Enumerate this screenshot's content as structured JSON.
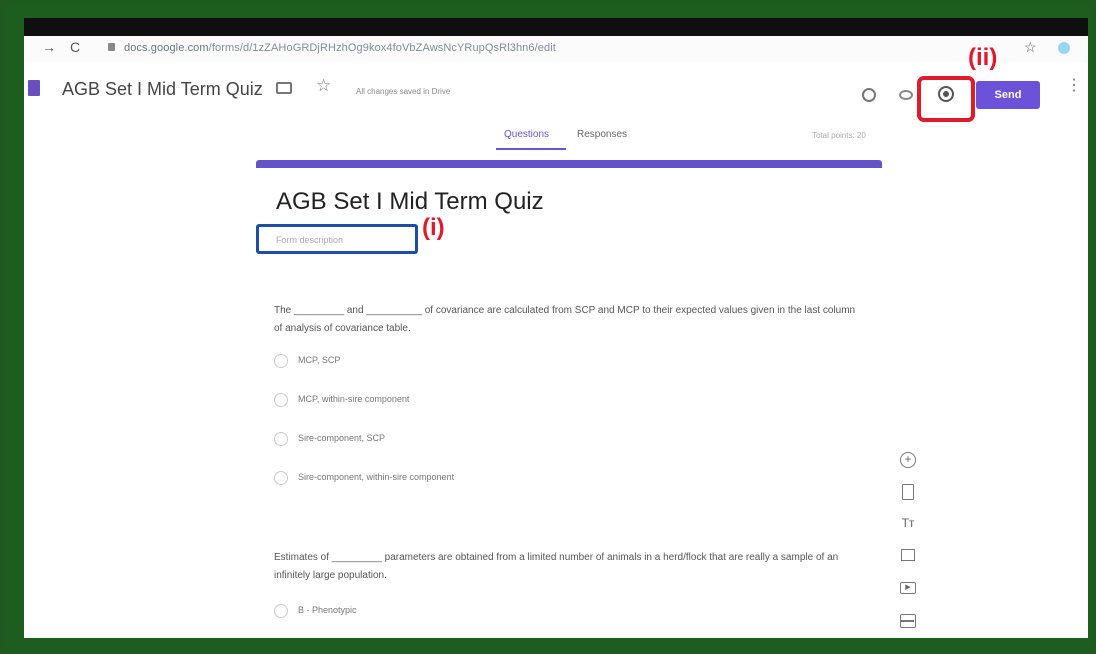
{
  "annotations": {
    "settings_marker": "(ii)",
    "description_marker": "(i)"
  },
  "browser": {
    "back_glyph": "→",
    "reload_glyph": "C",
    "url_host": "docs.google.com",
    "url_path": "/forms/d/1zZAHoGRDjRHzhOg9kox4foVbZAwsNcYRupQsRl3hn6/edit",
    "bookmark_glyph": "☆"
  },
  "header": {
    "title": "AGB Set I Mid Term Quiz",
    "saved_status": "All changes saved in Drive",
    "send_label": "Send",
    "star_glyph": "☆",
    "more_glyph": "⋮"
  },
  "tabs": [
    {
      "label": "Questions",
      "active": true
    },
    {
      "label": "Responses",
      "active": false
    }
  ],
  "total_points": "Total points: 20",
  "form": {
    "title": "AGB Set I Mid Term Quiz",
    "description_placeholder": "Form description"
  },
  "questions": [
    {
      "text": "The _________ and __________ of covariance are calculated from SCP and MCP to their expected values given in the last column of analysis of covariance table.",
      "options": [
        "MCP, SCP",
        "MCP, within-sire component",
        "Sire-component, SCP",
        "Sire-component, within-sire component"
      ]
    },
    {
      "text": "Estimates of _________ parameters are obtained from a limited number of animals in a herd/flock that are really a sample of an infinitely large population.",
      "options": [
        "B - Phenotypic"
      ]
    }
  ],
  "toolbar": {
    "add": "+",
    "title_text": "Tт",
    "video": "▶"
  },
  "colors": {
    "accent": "#6b52d8",
    "annotation_red": "#e01a2b",
    "annotation_blue": "#1c4ea8"
  }
}
